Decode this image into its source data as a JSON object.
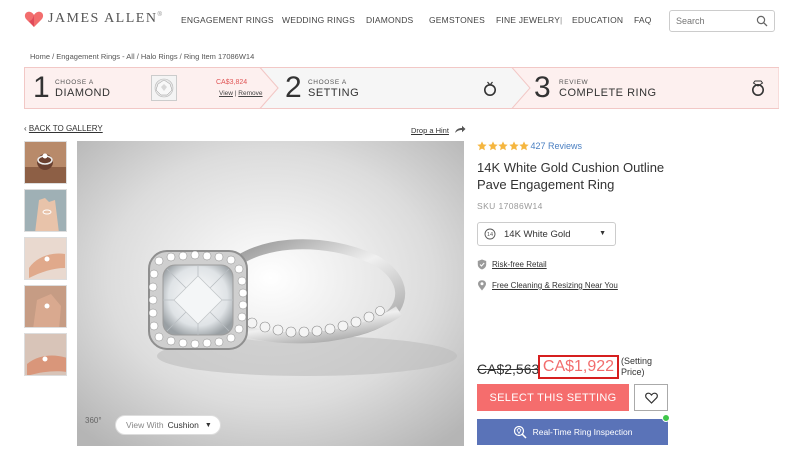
{
  "brand": {
    "name": "JAMES ALLEN",
    "trademark": "®",
    "accent": "#f26d6d"
  },
  "nav": {
    "items": [
      "ENGAGEMENT RINGS",
      "WEDDING RINGS",
      "DIAMONDS",
      "GEMSTONES",
      "FINE JEWELRY",
      "EDUCATION",
      "FAQ"
    ],
    "separator": "|"
  },
  "search": {
    "placeholder": "Search",
    "icon": "magnifier-icon"
  },
  "breadcrumb": "Home / Engagement Rings - All / Halo Rings / Ring Item 17086W14",
  "steps": [
    {
      "number": "1",
      "small": "CHOOSE A",
      "big": "DIAMOND",
      "price": "CA$3,824",
      "view": "View",
      "sep": " | ",
      "remove": "Remove",
      "icon": "diamond-thumbnail"
    },
    {
      "number": "2",
      "small": "CHOOSE A",
      "big": "SETTING",
      "icon": "ring-icon"
    },
    {
      "number": "3",
      "small": "REVIEW",
      "big": "COMPLETE RING",
      "icon": "ring-with-diamond-icon"
    }
  ],
  "gallery": {
    "back": "BACK TO GALLERY",
    "back_arrow": "‹",
    "hint": "Drop a Hint",
    "view_360": "360°",
    "view_with_label": "View With",
    "view_with_value": "Cushion"
  },
  "product": {
    "rating_stars": 5,
    "reviews": "427 Reviews",
    "title": "14K White Gold Cushion Outline Pave Engagement Ring",
    "sku": "SKU 17086W14",
    "metal": "14K White Gold",
    "features": [
      "Risk-free Retail",
      "Free Cleaning & Resizing Near You"
    ],
    "old_price": "CA$2,563",
    "price": "CA$1,922",
    "price_note_1": "(Setting",
    "price_note_2": "Price)",
    "select_button": "SELECT THIS SETTING",
    "inspection_button": "Real-Time Ring Inspection"
  },
  "colors": {
    "star": "#f5b63f",
    "select_button": "#f56d6d",
    "inspection_button": "#5a73b8",
    "highlight_box": "#d61f1f",
    "online": "#3fc64a"
  }
}
